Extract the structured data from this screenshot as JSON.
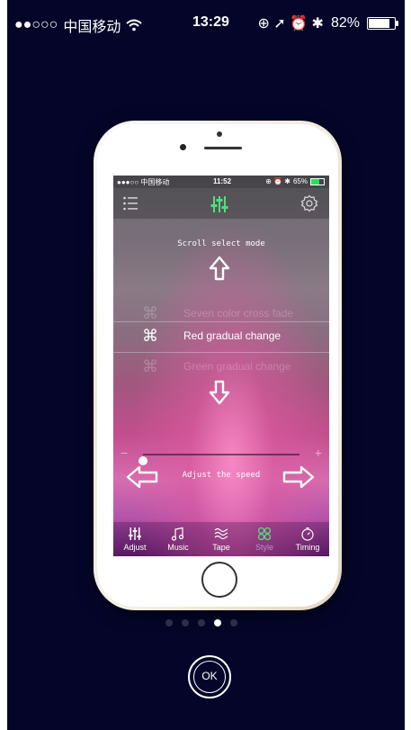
{
  "status_bar": {
    "signal": "●●○○○",
    "carrier": "中国移动",
    "wifi_icon": "wifi-icon",
    "time": "13:29",
    "indicators": "⊕ ➚ ⏰ ✱",
    "battery_percent": "82%",
    "battery_level": 0.82
  },
  "device": {
    "status_bar": {
      "signal": "●●●○○",
      "carrier": "中国移动",
      "time": "11:52",
      "indicators": "⊕ ⏰ ✱",
      "battery_percent": "65%",
      "battery_level": 0.65
    },
    "nav": {
      "menu_icon": "menu-icon",
      "center_icon": "mixer-icon",
      "settings_icon": "gear-icon"
    },
    "scroll_hint": "Scroll select mode",
    "modes": [
      {
        "symbol": "⌘",
        "label": "Seven color cross fade"
      },
      {
        "symbol": "⌘",
        "label": "Red gradual change"
      },
      {
        "symbol": "⌘",
        "label": "Green gradual change"
      }
    ],
    "speed": {
      "minus": "−",
      "plus": "+",
      "value": 0.0,
      "label": "Adjust the speed"
    },
    "tabs": [
      {
        "label": "Adjust",
        "icon": "mixer-icon"
      },
      {
        "label": "Music",
        "icon": "music-note-icon"
      },
      {
        "label": "Tape",
        "icon": "waves-icon"
      },
      {
        "label": "Style",
        "icon": "style-icon"
      },
      {
        "label": "Timing",
        "icon": "timer-icon"
      }
    ],
    "active_tab": "Style"
  },
  "pagination": {
    "count": 5,
    "active_index": 3
  },
  "ok_button": {
    "label": "OK"
  },
  "colors": {
    "background": "#05052a",
    "active_icon": "#4fe078",
    "active_tab_label": "#b78ed5"
  }
}
